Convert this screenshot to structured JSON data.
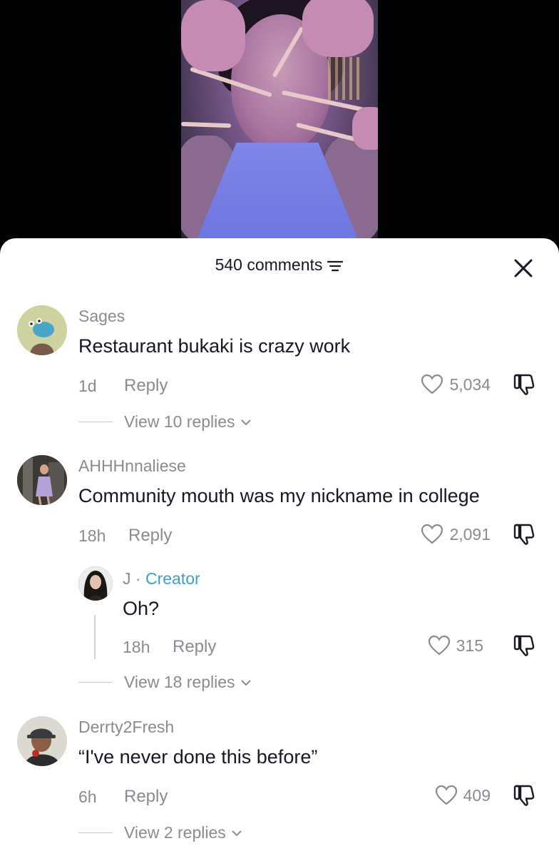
{
  "header": {
    "comment_count": "540 comments",
    "filter_icon": "filter-icon",
    "close_icon": "close-icon"
  },
  "comments": [
    {
      "username": "Sages",
      "text": "Restaurant bukaki is crazy work",
      "time": "1d",
      "reply_label": "Reply",
      "likes": "5,034",
      "view_replies": "View 10 replies"
    },
    {
      "username": "AHHHnnaliese",
      "text": "Community mouth was my nickname in college",
      "time": "18h",
      "reply_label": "Reply",
      "likes": "2,091",
      "view_replies": "View 18 replies",
      "reply": {
        "username": "J",
        "separator": " · ",
        "tag": "Creator",
        "text": "Oh?",
        "time": "18h",
        "reply_label": "Reply",
        "likes": "315"
      }
    },
    {
      "username": "Derrty2Fresh",
      "text": "“I've never done this before”",
      "time": "6h",
      "reply_label": "Reply",
      "likes": "409",
      "view_replies": "View 2 replies"
    }
  ],
  "colors": {
    "creator_tag": "#3ba0c6",
    "muted_text": "#8a8b91",
    "primary_text": "#161823"
  }
}
